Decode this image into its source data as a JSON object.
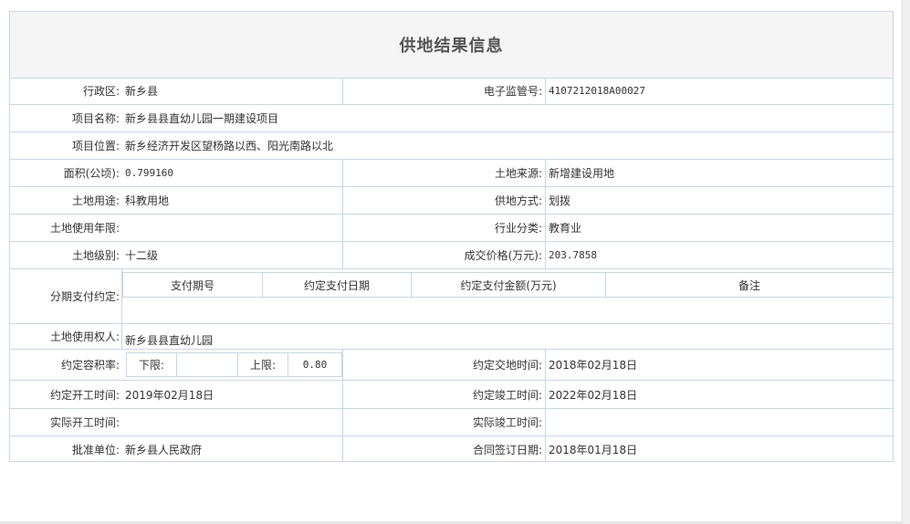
{
  "title": "供地结果信息",
  "fields": {
    "district_label": "行政区:",
    "district_value": "新乡县",
    "supervision_no_label": "电子监管号:",
    "supervision_no_value": "4107212018A00027",
    "project_name_label": "项目名称:",
    "project_name_value": "新乡县县直幼儿园一期建设项目",
    "project_location_label": "项目位置:",
    "project_location_value": "新乡经济开发区望杨路以西、阳光南路以北",
    "area_label": "面积(公顷):",
    "area_value": "0.799160",
    "land_source_label": "土地来源:",
    "land_source_value": "新增建设用地",
    "land_use_label": "土地用途:",
    "land_use_value": "科教用地",
    "supply_method_label": "供地方式:",
    "supply_method_value": "划拨",
    "use_term_label": "土地使用年限:",
    "use_term_value": "",
    "industry_label": "行业分类:",
    "industry_value": "教育业",
    "land_grade_label": "土地级别:",
    "land_grade_value": "十二级",
    "price_label": "成交价格(万元):",
    "price_value": "203.7858",
    "installment_label": "分期支付约定:",
    "owner_label": "土地使用权人:",
    "owner_value": "新乡县县直幼儿园",
    "plot_ratio_label": "约定容积率:",
    "plot_ratio_lower_label": "下限:",
    "plot_ratio_lower_value": "",
    "plot_ratio_upper_label": "上限:",
    "plot_ratio_upper_value": "0.80",
    "handover_time_label": "约定交地时间:",
    "handover_time_value": "2018年02月18日",
    "start_time_label": "约定开工时间:",
    "start_time_value": "2019年02月18日",
    "completion_time_label": "约定竣工时间:",
    "completion_time_value": "2022年02月18日",
    "actual_start_label": "实际开工时间:",
    "actual_start_value": "",
    "actual_completion_label": "实际竣工时间:",
    "actual_completion_value": "",
    "approval_unit_label": "批准单位:",
    "approval_unit_value": "新乡县人民政府",
    "contract_date_label": "合同签订日期:",
    "contract_date_value": "2018年01月18日"
  },
  "installment_table": {
    "headers": [
      "支付期号",
      "约定支付日期",
      "约定支付金额(万元)",
      "备注"
    ]
  },
  "colors": {
    "border": "#c9d6e3",
    "title_bg": "#f5f5f5",
    "text": "#333333"
  }
}
